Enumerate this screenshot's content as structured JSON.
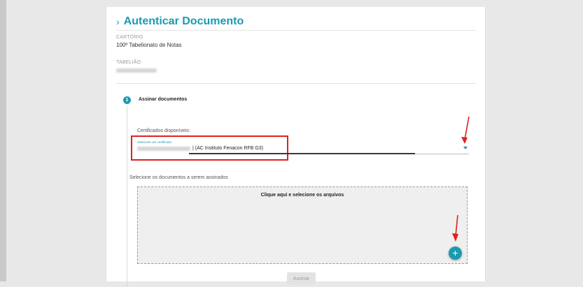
{
  "page": {
    "title": "Autenticar Documento",
    "cartorio": {
      "label": "CARTÓRIO",
      "value": "100º Tabelionato de Notas"
    },
    "tabeliao": {
      "label": "TABELIÃO"
    }
  },
  "step": {
    "number": "1",
    "label": "Assinar documentos"
  },
  "certificates": {
    "label": "Certificados disponíveis:",
    "select_hint": "Selecione um certificado",
    "selected_value": "| (AC Instituto Fenacon RFB G3)"
  },
  "documents": {
    "label": "Selecione os documentos a serem assinados",
    "dropzone_text": "Clique aqui e selecione os arquivos",
    "add_button_label": "+"
  },
  "actions": {
    "sign_label": "Assinar"
  },
  "colors": {
    "accent": "#1a9bb0",
    "highlight": "#e02020"
  },
  "icons": {
    "title": "chevron-right-icon",
    "select": "caret-down-icon",
    "add": "plus-icon",
    "annotation": "red-arrow-icon"
  }
}
